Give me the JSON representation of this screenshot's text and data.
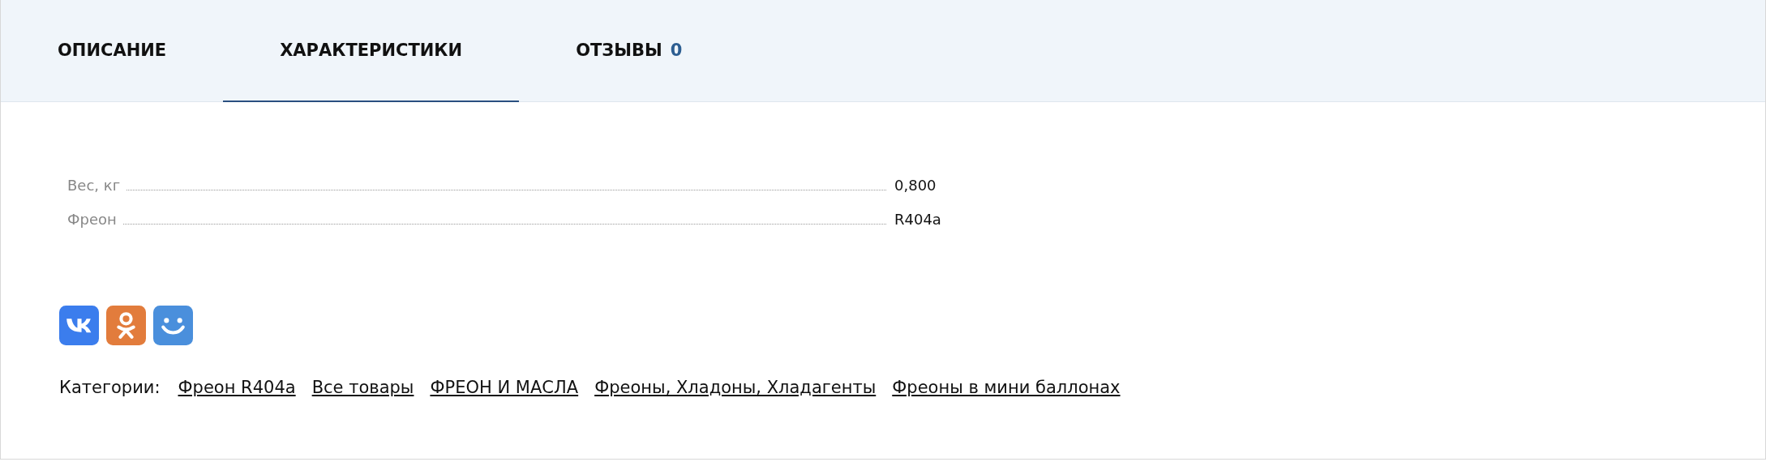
{
  "tabs": [
    {
      "label": "ОПИСАНИЕ",
      "selected": false
    },
    {
      "label": "ХАРАКТЕРИСТИКИ",
      "selected": true
    },
    {
      "label": "ОТЗЫВЫ",
      "count": "0",
      "selected": false
    }
  ],
  "specs": [
    {
      "name": "Вес, кг",
      "value": "0,800"
    },
    {
      "name": "Фреон",
      "value": "R404a"
    }
  ],
  "categories": {
    "label": "Категории:",
    "links": [
      "Фреон R404a",
      "Все товары",
      "ФРЕОН И МАСЛА",
      "Фреоны, Хладоны, Хладагенты",
      "Фреоны в мини баллонах"
    ]
  }
}
